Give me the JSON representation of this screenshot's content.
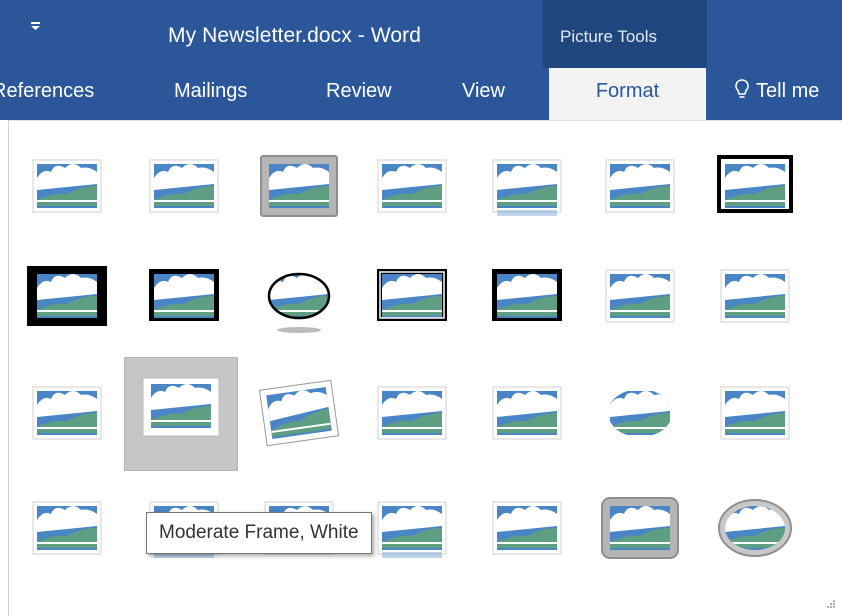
{
  "app": {
    "title": "My Newsletter.docx - Word",
    "context_group": "Picture Tools",
    "qat_glyph": "≡"
  },
  "tabs": [
    {
      "label": "References"
    },
    {
      "label": "Mailings"
    },
    {
      "label": "Review"
    },
    {
      "label": "View"
    },
    {
      "label": "Format"
    }
  ],
  "tellme": {
    "label": "Tell me"
  },
  "colors": {
    "ribbon_blue": "#2b579a",
    "sky": "#4a86c5",
    "cloud": "#ffffff",
    "hill": "#5e9e82",
    "frame_black": "#000000",
    "selected_bg": "#c6c6c6"
  },
  "gallery": {
    "styles": [
      "simple-frame-white",
      "beveled-matte-white",
      "metal-frame",
      "drop-shadow-rectangle",
      "reflected-rounded-rectangle",
      "soft-edge-rectangle",
      "double-frame-black",
      "thick-matte-black",
      "simple-frame-black",
      "beveled-oval-black",
      "compound-frame-black",
      "moderate-frame-black",
      "center-shadow-rectangle",
      "rounded-diagonal-corner-white",
      "snip-diagonal-corner-white",
      "moderate-frame-white",
      "rotated-white",
      "perspective-shadow-white",
      "relaxed-perspective-white",
      "soft-edge-oval",
      "bevel-rectangle",
      "bevel-perspective",
      "reflected-bevel-white",
      "bevel-perspective-left-white",
      "reflected-perspective-right",
      "beveled-reflection-white",
      "metal-rounded-rectangle",
      "metal-oval"
    ],
    "selected_index": 15
  },
  "tooltip": {
    "text": "Moderate Frame, White"
  }
}
